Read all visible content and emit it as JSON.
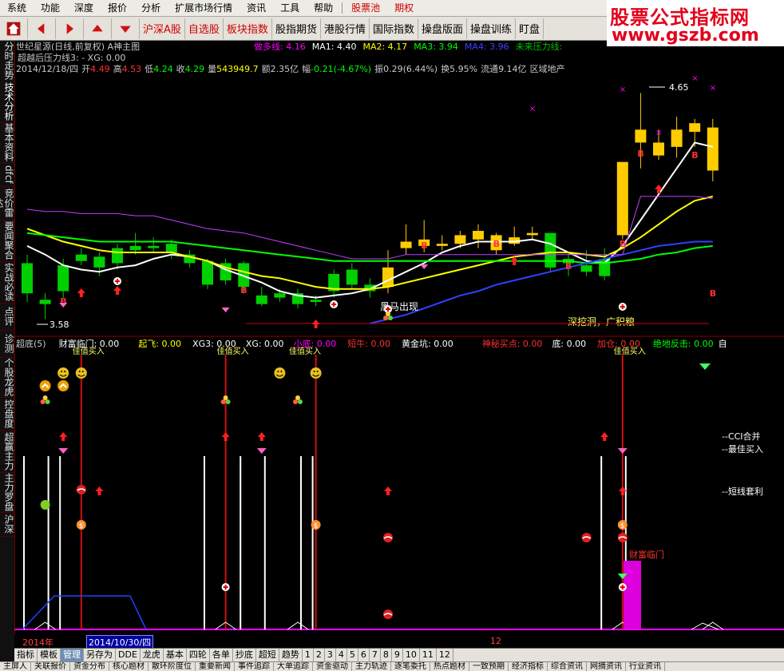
{
  "menu": {
    "items": [
      "系统",
      "功能",
      "深度",
      "报价",
      "分析",
      "扩展市场行情",
      "资讯",
      "工具",
      "帮助"
    ],
    "special": [
      "股票池",
      "期权"
    ]
  },
  "toolbar": {
    "nav": [
      "home-icon",
      "arrow-left-icon",
      "arrow-right-icon",
      "arrow-up-icon",
      "arrow-down-icon"
    ],
    "labels": [
      "沪深A股",
      "自选股",
      "板块指数",
      "股指期货",
      "港股行情",
      "国际指数",
      "操盘版面",
      "操盘训练",
      "盯盘"
    ]
  },
  "watermark": {
    "line1": "股票公式指标网",
    "line2": "www.gszb.com"
  },
  "sidebar": {
    "tabs": [
      "分时走势",
      "技术分析",
      "基本资料",
      "dfcf",
      "竞价雷达",
      "要闻聚合",
      "实战必读",
      "点评",
      "诊测",
      "个股龙虎",
      "控盘度",
      "超赢主力",
      "主力罗盘",
      "沪深"
    ]
  },
  "price_header": {
    "stock": "世纪星源(日线,前复权) A神主图",
    "indicators": [
      {
        "label": "做多线:",
        "value": "4.16",
        "color": "#ff00ff"
      },
      {
        "label": "MA1:",
        "value": "4.40",
        "color": "#ffffff"
      },
      {
        "label": "MA2:",
        "value": "4.17",
        "color": "#ffff00"
      },
      {
        "label": "MA3:",
        "value": "3.94",
        "color": "#00ff00"
      },
      {
        "label": "MA4:",
        "value": "3.96",
        "color": "#4040ff"
      },
      {
        "label": "未来压力线:",
        "value": "",
        "color": "#00c000"
      }
    ],
    "line2": "超越后压力线3: - XG: 0.00",
    "quote": {
      "date": "2014/12/18/四",
      "open_label": "开",
      "open": "4.49",
      "high_label": "高",
      "high": "4.53",
      "low_label": "低",
      "low": "4.24",
      "close_label": "收",
      "close": "4.29",
      "vol_label": "量",
      "vol": "543949.7",
      "amt_label": "额",
      "amt": "2.35亿",
      "chg_label": "幅",
      "chg": "-0.21(-4.67%)",
      "amp_label": "振",
      "amp": "0.29(6.44%)",
      "turn_label": "换",
      "turn": "5.95%",
      "float_label": "流通",
      "float": "9.14亿",
      "sector": "区域地产"
    }
  },
  "chart_annotations": {
    "high_price": "4.65",
    "low_price": "3.58",
    "black_horse": "黑马出现",
    "deep_dig": "深挖洞，广积粮"
  },
  "lower_header": {
    "items": [
      {
        "label": "超底(5)",
        "value": "",
        "color": "#cccccc"
      },
      {
        "label": "财富临门:",
        "value": "0.00",
        "color": "#ffffff"
      },
      {
        "label": "起飞:",
        "value": "0.00",
        "color": "#ffff00"
      },
      {
        "label": "XG3:",
        "value": "0.00",
        "color": "#ffffff"
      },
      {
        "label": "XG:",
        "value": "0.00",
        "color": "#ffffff"
      },
      {
        "label": "小底:",
        "value": "0.00",
        "color": "#ff00ff"
      },
      {
        "label": "短牛:",
        "value": "0.00",
        "color": "#ff3030"
      },
      {
        "label": "黄金坑:",
        "value": "0.00",
        "color": "#ffffff"
      },
      {
        "label": "神秘买点:",
        "value": "0.00",
        "color": "#ff3030"
      },
      {
        "label": "底:",
        "value": "0.00",
        "color": "#ffffff"
      },
      {
        "label": "加仓:",
        "value": "0.00",
        "color": "#ff3030"
      },
      {
        "label": "绝地反击:",
        "value": "0.00",
        "color": "#00ff00"
      },
      {
        "label": "自",
        "value": "",
        "color": "#ffffff"
      }
    ]
  },
  "lower_annotations": {
    "cci": "--CCI合并",
    "best_buy": "--最佳买入",
    "short_arb": "--短线套利",
    "wealth": "财富临门",
    "signal_top": "佳值买入"
  },
  "time_axis": {
    "year": "2014年",
    "date": "2014/10/30/四",
    "month": "12"
  },
  "bottom_tabs": [
    "指标",
    "模板",
    "管理",
    "另存为",
    "DDE",
    "龙虎",
    "基本",
    "四轮",
    "各单",
    "抄底",
    "超短",
    "趋势",
    "1",
    "2",
    "3",
    "4",
    "5",
    "6",
    "7",
    "8",
    "9",
    "10",
    "11",
    "12"
  ],
  "bottom_active": "管理",
  "status_items": [
    "主屏人",
    "关联报价",
    "资金分布",
    "核心题材",
    "散环阶度位",
    "重要新闻",
    "事件追踪",
    "大单追踪",
    "资金驱动",
    "主力轨迹",
    "逐笔委托",
    "热点题材",
    "一致预期",
    "经济指标",
    "综合资讯",
    "网摘资讯",
    "行业资讯"
  ],
  "chart_data": {
    "type": "candlestick",
    "title": "世纪星源(日线,前复权)",
    "ylim": [
      3.55,
      4.7
    ],
    "candles": [
      {
        "o": 3.72,
        "c": 3.86,
        "h": 3.9,
        "l": 3.68
      },
      {
        "o": 3.69,
        "c": 3.67,
        "h": 3.72,
        "l": 3.6
      },
      {
        "o": 3.73,
        "c": 3.85,
        "h": 3.88,
        "l": 3.7
      },
      {
        "o": 3.87,
        "c": 3.9,
        "h": 3.93,
        "l": 3.85
      },
      {
        "o": 3.84,
        "c": 3.89,
        "h": 3.91,
        "l": 3.8
      },
      {
        "o": 3.86,
        "c": 3.93,
        "h": 3.95,
        "l": 3.83
      },
      {
        "o": 3.92,
        "c": 3.94,
        "h": 4.0,
        "l": 3.9
      },
      {
        "o": 3.93,
        "c": 3.94,
        "h": 3.98,
        "l": 3.91
      },
      {
        "o": 3.95,
        "c": 3.91,
        "h": 3.97,
        "l": 3.88
      },
      {
        "o": 3.9,
        "c": 3.86,
        "h": 3.92,
        "l": 3.84
      },
      {
        "o": 3.87,
        "c": 3.76,
        "h": 3.88,
        "l": 3.74
      },
      {
        "o": 3.86,
        "c": 3.78,
        "h": 3.88,
        "l": 3.76
      },
      {
        "o": 3.86,
        "c": 3.75,
        "h": 3.87,
        "l": 3.72
      },
      {
        "o": 3.71,
        "c": 3.67,
        "h": 3.75,
        "l": 3.66
      },
      {
        "o": 3.72,
        "c": 3.7,
        "h": 3.74,
        "l": 3.68
      },
      {
        "o": 3.67,
        "c": 3.72,
        "h": 3.74,
        "l": 3.65
      },
      {
        "o": 3.68,
        "c": 3.69,
        "h": 3.71,
        "l": 3.66
      },
      {
        "o": 3.73,
        "c": 3.81,
        "h": 3.83,
        "l": 3.7
      },
      {
        "o": 3.76,
        "c": 3.83,
        "h": 3.86,
        "l": 3.74
      },
      {
        "o": 3.73,
        "c": 3.76,
        "h": 3.79,
        "l": 3.7
      },
      {
        "o": 3.75,
        "c": 3.84,
        "h": 3.92,
        "l": 3.72
      },
      {
        "o": 3.96,
        "c": 3.93,
        "h": 4.04,
        "l": 3.9
      },
      {
        "o": 3.94,
        "c": 3.97,
        "h": 4.06,
        "l": 3.91
      },
      {
        "o": 3.95,
        "c": 3.94,
        "h": 3.99,
        "l": 3.92
      },
      {
        "o": 3.95,
        "c": 3.99,
        "h": 4.01,
        "l": 3.93
      },
      {
        "o": 4.01,
        "c": 3.97,
        "h": 4.04,
        "l": 3.93
      },
      {
        "o": 3.99,
        "c": 3.92,
        "h": 4.0,
        "l": 3.9
      },
      {
        "o": 3.95,
        "c": 3.98,
        "h": 4.03,
        "l": 3.94
      },
      {
        "o": 3.99,
        "c": 4.0,
        "h": 4.03,
        "l": 3.97
      },
      {
        "o": 4.0,
        "c": 3.84,
        "h": 4.0,
        "l": 3.82
      },
      {
        "o": 3.88,
        "c": 3.86,
        "h": 3.91,
        "l": 3.8
      },
      {
        "o": 3.85,
        "c": 3.82,
        "h": 3.92,
        "l": 3.8
      },
      {
        "o": 3.88,
        "c": 3.8,
        "h": 3.93,
        "l": 3.78
      },
      {
        "o": 3.99,
        "c": 4.33,
        "h": 4.33,
        "l": 3.97
      },
      {
        "o": 4.42,
        "c": 4.48,
        "h": 4.65,
        "l": 4.3
      },
      {
        "o": 4.36,
        "c": 4.42,
        "h": 4.48,
        "l": 4.34
      },
      {
        "o": 4.4,
        "c": 4.48,
        "h": 4.54,
        "l": 4.35
      },
      {
        "o": 4.47,
        "c": 4.51,
        "h": 4.53,
        "l": 4.4
      },
      {
        "o": 4.49,
        "c": 4.29,
        "h": 4.53,
        "l": 4.24
      }
    ],
    "series": [
      {
        "name": "MA1",
        "color": "#ffffff",
        "values": [
          3.94,
          3.9,
          3.85,
          3.83,
          3.82,
          3.84,
          3.85,
          3.88,
          3.9,
          3.89,
          3.87,
          3.83,
          3.8,
          3.77,
          3.73,
          3.71,
          3.7,
          3.71,
          3.72,
          3.74,
          3.78,
          3.82,
          3.86,
          3.91,
          3.94,
          3.96,
          3.96,
          3.96,
          3.97,
          3.95,
          3.91,
          3.87,
          3.86,
          3.94,
          4.06,
          4.18,
          4.3,
          4.42,
          4.4
        ]
      },
      {
        "name": "MA2",
        "color": "#ffff00",
        "values": [
          4.02,
          3.99,
          3.96,
          3.94,
          3.92,
          3.91,
          3.91,
          3.91,
          3.91,
          3.89,
          3.87,
          3.84,
          3.82,
          3.8,
          3.79,
          3.77,
          3.75,
          3.74,
          3.74,
          3.74,
          3.75,
          3.77,
          3.79,
          3.81,
          3.83,
          3.85,
          3.87,
          3.89,
          3.9,
          3.91,
          3.91,
          3.9,
          3.89,
          3.93,
          3.98,
          4.04,
          4.1,
          4.15,
          4.17
        ]
      },
      {
        "name": "MA3",
        "color": "#00ff00",
        "values": [
          4.0,
          3.99,
          3.98,
          3.97,
          3.96,
          3.96,
          3.96,
          3.96,
          3.96,
          3.95,
          3.94,
          3.93,
          3.92,
          3.91,
          3.9,
          3.89,
          3.88,
          3.87,
          3.87,
          3.87,
          3.87,
          3.87,
          3.87,
          3.87,
          3.87,
          3.87,
          3.87,
          3.87,
          3.87,
          3.87,
          3.87,
          3.86,
          3.86,
          3.87,
          3.88,
          3.9,
          3.91,
          3.93,
          3.94
        ]
      },
      {
        "name": "MA4",
        "color": "#3040ff",
        "values": [
          null,
          null,
          null,
          null,
          null,
          null,
          null,
          null,
          null,
          null,
          null,
          null,
          null,
          null,
          null,
          null,
          null,
          null,
          null,
          3.58,
          3.6,
          3.62,
          3.65,
          3.68,
          3.71,
          3.73,
          3.76,
          3.78,
          3.8,
          3.82,
          3.84,
          3.86,
          3.88,
          3.9,
          3.92,
          3.94,
          3.95,
          3.96,
          3.96
        ]
      },
      {
        "name": "做多线",
        "color": "#c040ff",
        "values": [
          4.11,
          4.1,
          4.1,
          4.09,
          4.09,
          4.09,
          4.08,
          4.08,
          4.06,
          4.04,
          4.02,
          4.01,
          4.0,
          3.98,
          3.96,
          3.94,
          3.92,
          3.9,
          3.88,
          3.88,
          3.88,
          3.9,
          3.9,
          3.9,
          3.9,
          3.9,
          3.9,
          3.9,
          3.9,
          3.9,
          3.9,
          3.9,
          3.9,
          3.9,
          4.17,
          4.17,
          4.17,
          4.17,
          4.16
        ]
      }
    ]
  }
}
